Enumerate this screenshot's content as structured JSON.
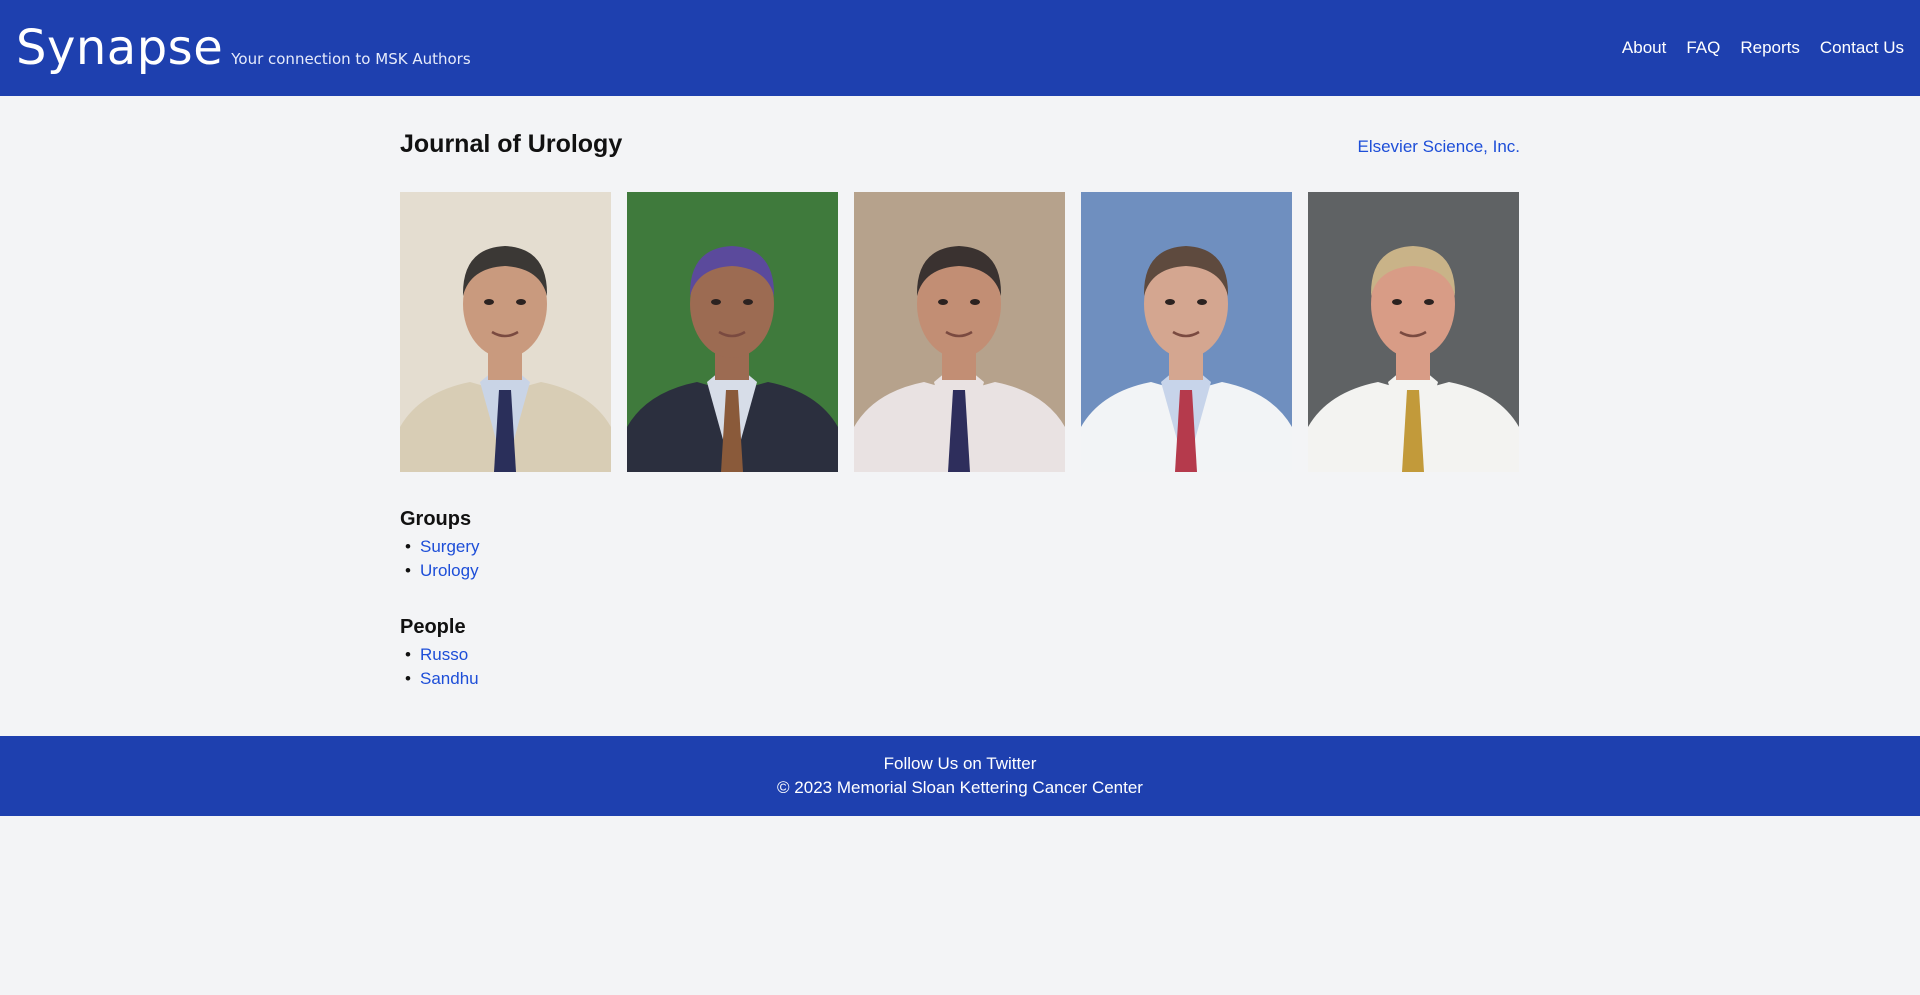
{
  "header": {
    "brand": "Synapse",
    "tagline": "Your connection to MSK Authors",
    "nav": [
      "About",
      "FAQ",
      "Reports",
      "Contact Us"
    ]
  },
  "journal": {
    "title": "Journal of Urology",
    "publisher": "Elsevier Science, Inc."
  },
  "photos": [
    {
      "name": "author-photo-1",
      "bg": "#e4ddd0",
      "suit": "#d8cdb5",
      "shirt": "#c9d4e6",
      "tie": "#2a2f5a",
      "skin": "#c99a7e",
      "hair": "#3b3835"
    },
    {
      "name": "author-photo-2",
      "bg": "#3f7a3c",
      "suit": "#2b2f3e",
      "shirt": "#d7dde8",
      "tie": "#8a5a3a",
      "skin": "#9c6b52",
      "hair": "#5b4a9c"
    },
    {
      "name": "author-photo-3",
      "bg": "#b6a28c",
      "suit": "#e9e2e2",
      "shirt": "#e9e2e2",
      "tie": "#2e2e5c",
      "skin": "#c28e74",
      "hair": "#3a3230"
    },
    {
      "name": "author-photo-4",
      "bg": "#6f8fbf",
      "suit": "#f2f4f6",
      "shirt": "#c7d4ea",
      "tie": "#b53a4c",
      "skin": "#d4a690",
      "hair": "#5e4a3e"
    },
    {
      "name": "author-photo-5",
      "bg": "#5f6264",
      "suit": "#f3f3f1",
      "shirt": "#f3f3f1",
      "tie": "#c29a3a",
      "skin": "#d89c86",
      "hair": "#c9b388"
    }
  ],
  "groups": {
    "heading": "Groups",
    "items": [
      "Surgery",
      "Urology"
    ]
  },
  "people": {
    "heading": "People",
    "items": [
      "Russo",
      "Sandhu"
    ]
  },
  "footer": {
    "twitter": "Follow Us on Twitter",
    "copyright": "© 2023 Memorial Sloan Kettering Cancer Center"
  }
}
